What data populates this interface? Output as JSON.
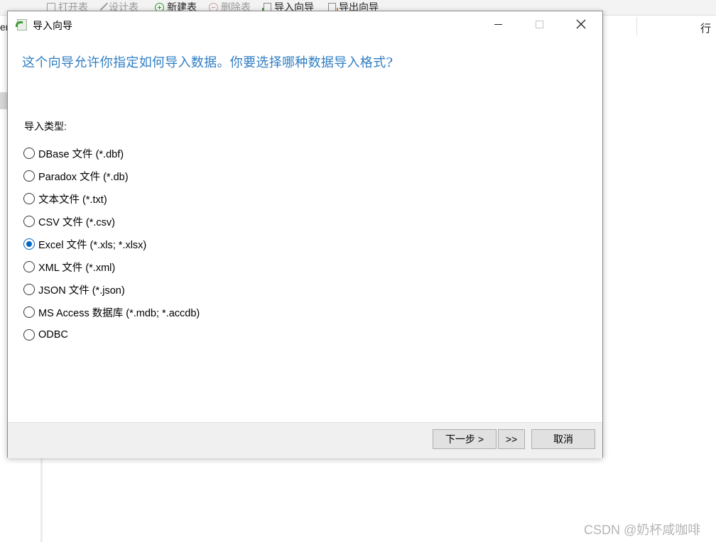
{
  "background": {
    "toolbar": [
      {
        "label": "打开表",
        "icon": "open-table-icon",
        "disabled": true
      },
      {
        "label": "设计表",
        "icon": "design-table-icon",
        "disabled": true
      },
      {
        "label": "新建表",
        "icon": "new-table-icon",
        "disabled": false
      },
      {
        "label": "删除表",
        "icon": "delete-table-icon",
        "disabled": true
      },
      {
        "label": "导入向导",
        "icon": "import-wizard-icon",
        "disabled": false
      },
      {
        "label": "导出向导",
        "icon": "export-wizard-icon",
        "disabled": false
      }
    ],
    "left_fragment": "er",
    "right_fragment": "行"
  },
  "dialog": {
    "title": "导入向导",
    "question": "这个向导允许你指定如何导入数据。你要选择哪种数据导入格式?",
    "group_label": "导入类型:",
    "options": [
      {
        "label": "DBase 文件 (*.dbf)",
        "checked": false
      },
      {
        "label": "Paradox 文件 (*.db)",
        "checked": false
      },
      {
        "label": "文本文件 (*.txt)",
        "checked": false
      },
      {
        "label": "CSV 文件 (*.csv)",
        "checked": false
      },
      {
        "label": "Excel 文件 (*.xls; *.xlsx)",
        "checked": true
      },
      {
        "label": "XML 文件 (*.xml)",
        "checked": false
      },
      {
        "label": "JSON 文件 (*.json)",
        "checked": false
      },
      {
        "label": "MS Access 数据库 (*.mdb; *.accdb)",
        "checked": false
      },
      {
        "label": "ODBC",
        "checked": false
      }
    ],
    "buttons": {
      "next": "下一步 >",
      "fast_forward": ">>",
      "cancel": "取消"
    },
    "window_controls": {
      "close_glyph": "✕"
    }
  },
  "watermark": "CSDN @奶杯咸咖啡",
  "colors": {
    "question_text": "#2f7ec4",
    "radio_checked": "#0067c0",
    "footer_bg": "#f0f0f0"
  }
}
